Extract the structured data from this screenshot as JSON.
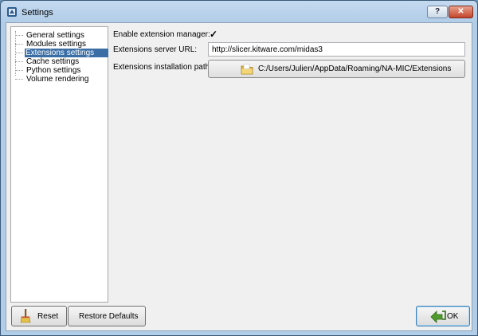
{
  "window": {
    "title": "Settings",
    "help_label": "?",
    "close_label": "✕"
  },
  "sidebar": {
    "items": [
      {
        "label": "General settings",
        "selected": false
      },
      {
        "label": "Modules settings",
        "selected": false
      },
      {
        "label": "Extensions settings",
        "selected": true
      },
      {
        "label": "Cache settings",
        "selected": false
      },
      {
        "label": "Python settings",
        "selected": false
      },
      {
        "label": "Volume rendering",
        "selected": false
      }
    ]
  },
  "form": {
    "enable_label": "Enable extension manager:",
    "enable_checked": true,
    "checkmark": "✓",
    "url_label": "Extensions server URL:",
    "url_value": "http://slicer.kitware.com/midas3",
    "path_label": "Extensions installation path:",
    "path_value": "C:/Users/Julien/AppData/Roaming/NA-MIC/Extensions"
  },
  "buttons": {
    "reset": "Reset",
    "restore": "Restore Defaults",
    "ok": "OK"
  },
  "colors": {
    "selection": "#3a6ea5",
    "titlebar": "#b2cde8",
    "close": "#c4452b"
  }
}
